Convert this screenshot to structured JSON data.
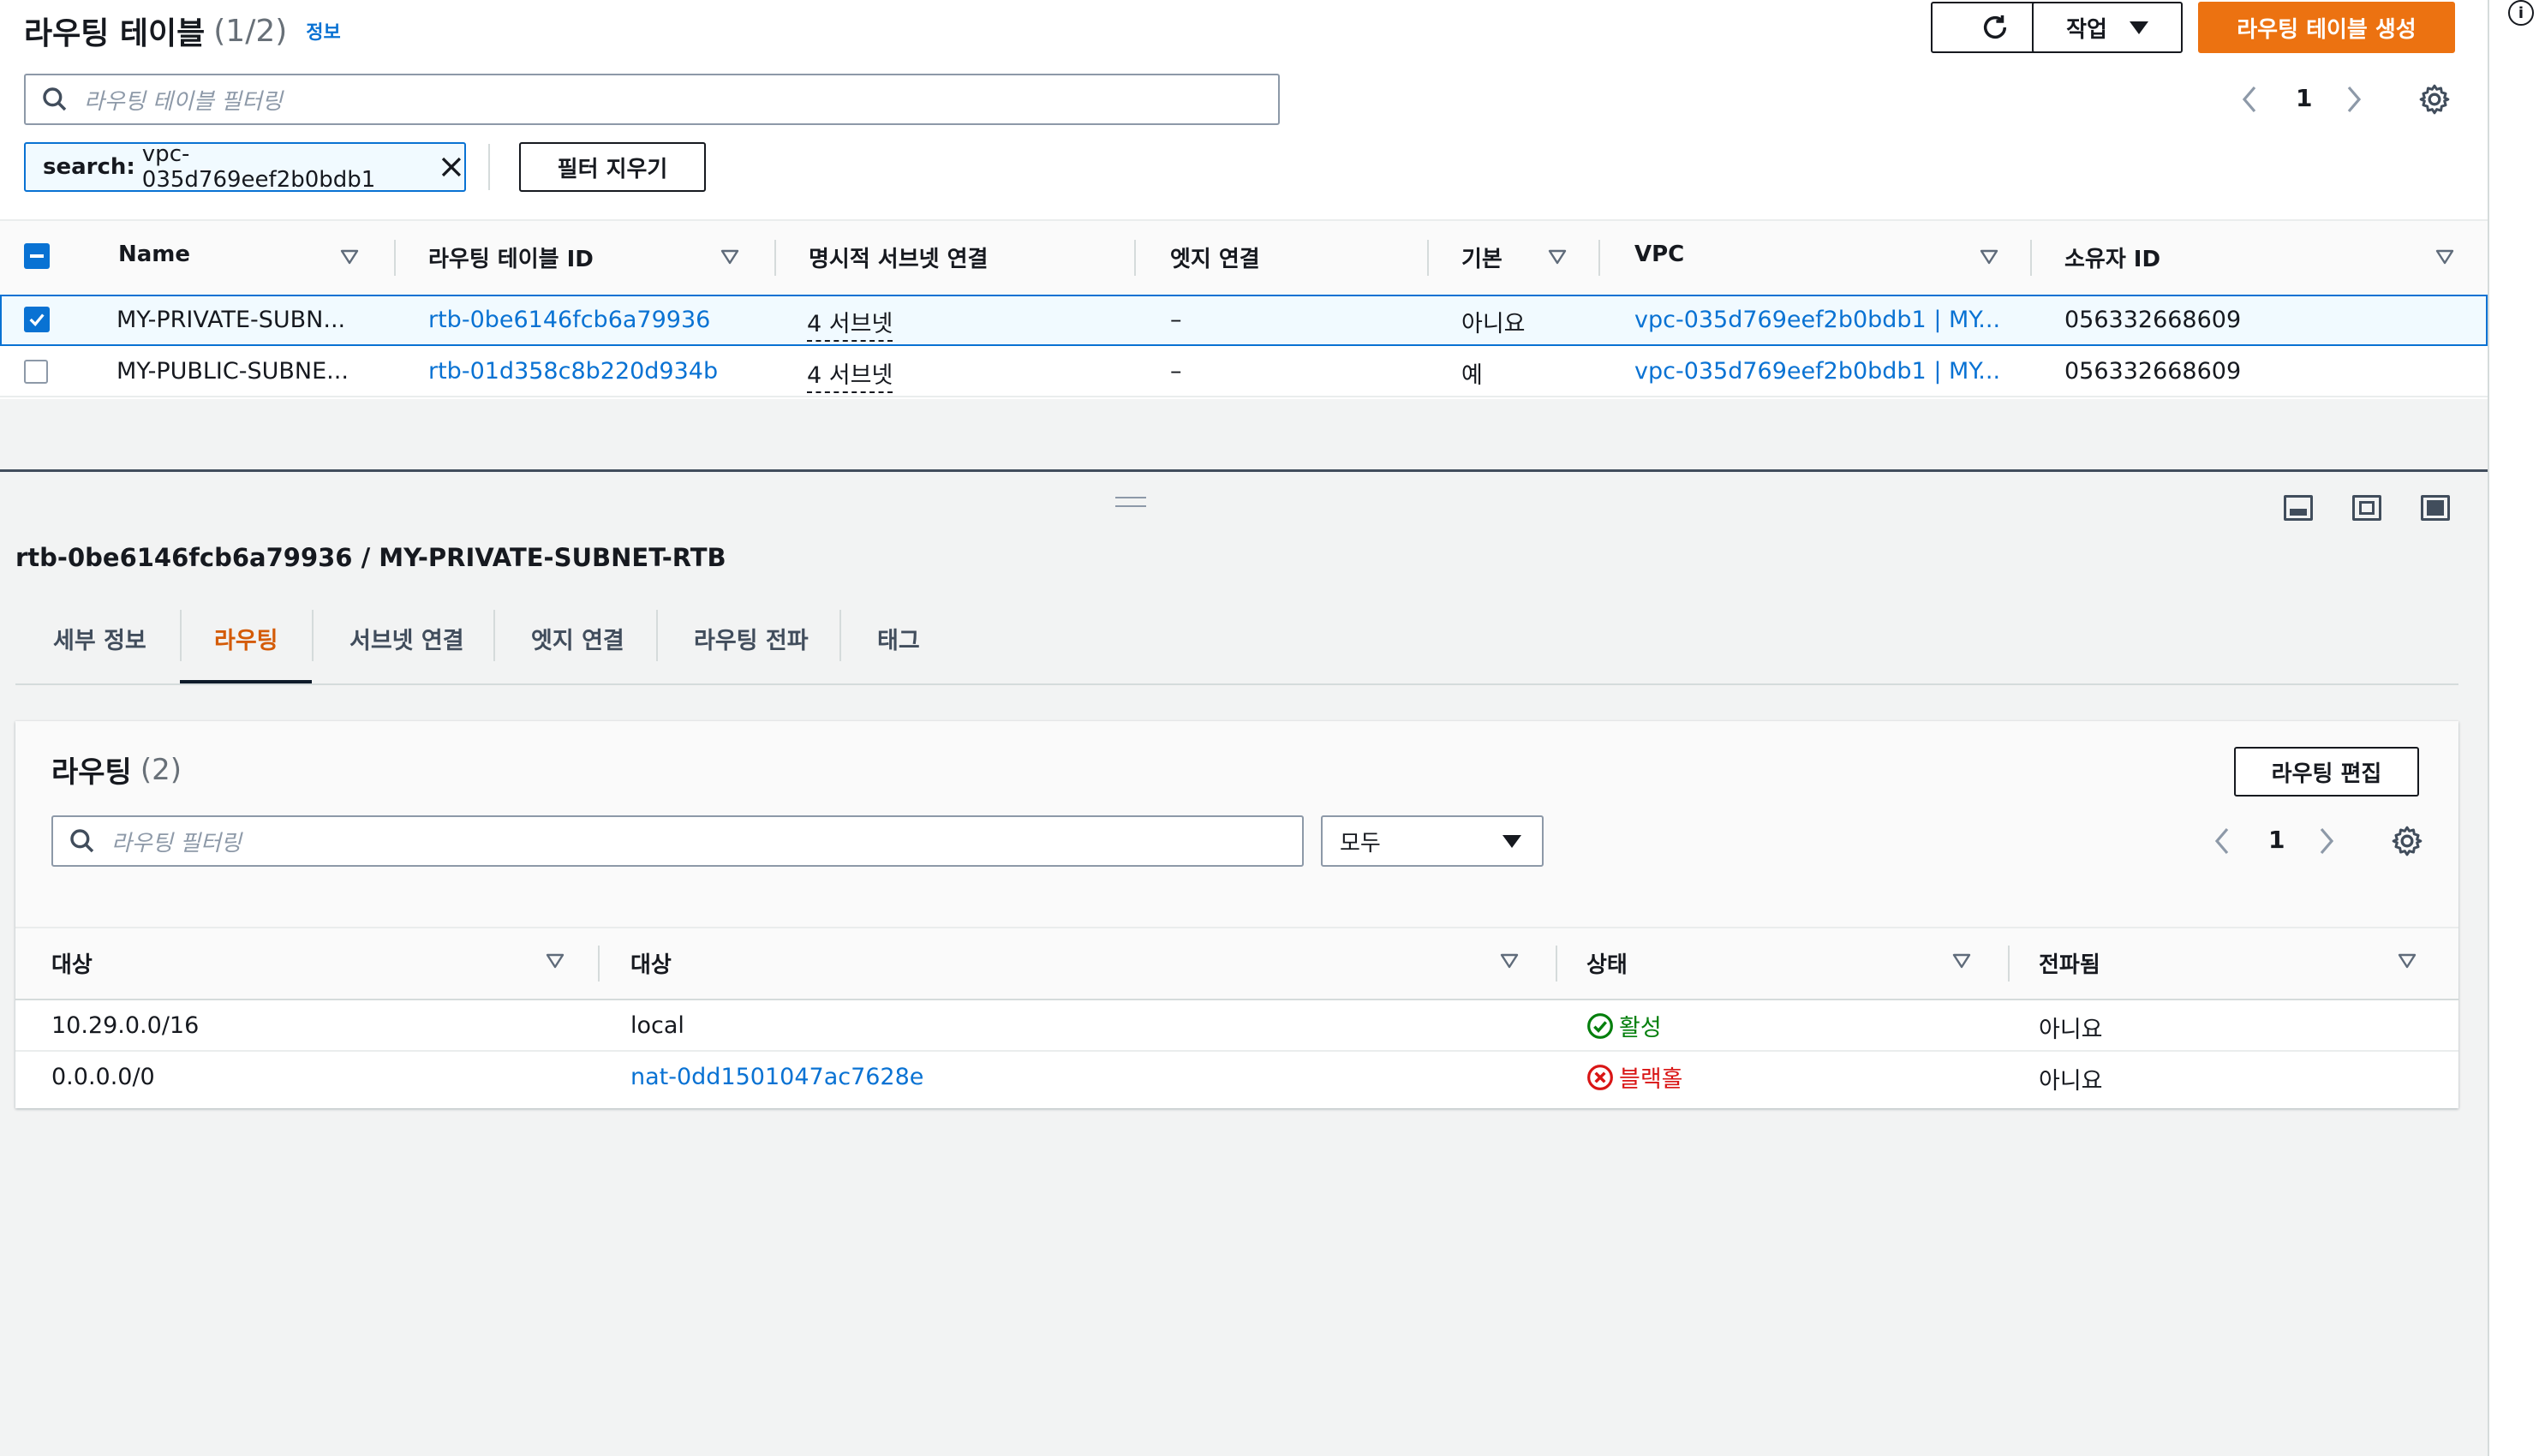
{
  "top": {
    "title": "라우팅 테이블",
    "count": "(1/2)",
    "info_link": "정보",
    "action_label": "작업",
    "create_label": "라우팅 테이블 생성",
    "search_placeholder": "라우팅 테이블 필터링",
    "page": "1",
    "filter_token_key": "search:",
    "filter_token_value": "vpc-035d769eef2b0bdb1",
    "clear_filters": "필터 지우기",
    "columns": [
      "Name",
      "라우팅 테이블 ID",
      "명시적 서브넷 연결",
      "엣지 연결",
      "기본",
      "VPC",
      "소유자 ID"
    ],
    "rows": [
      {
        "checked": true,
        "name": "MY-PRIVATE-SUBN...",
        "id": "rtb-0be6146fcb6a79936",
        "subnets": "4 서브넷",
        "edge": "–",
        "main": "아니요",
        "vpc": "vpc-035d769eef2b0bdb1 | MY...",
        "owner": "056332668609"
      },
      {
        "checked": false,
        "name": "MY-PUBLIC-SUBNE...",
        "id": "rtb-01d358c8b220d934b",
        "subnets": "4 서브넷",
        "edge": "–",
        "main": "예",
        "vpc": "vpc-035d769eef2b0bdb1 | MY...",
        "owner": "056332668609"
      }
    ]
  },
  "detail": {
    "title": "rtb-0be6146fcb6a79936 / MY-PRIVATE-SUBNET-RTB",
    "tabs": [
      "세부 정보",
      "라우팅",
      "서브넷 연결",
      "엣지 연결",
      "라우팅 전파",
      "태그"
    ],
    "active_tab": 1
  },
  "routes": {
    "title": "라우팅",
    "count": "(2)",
    "edit_label": "라우팅 편집",
    "search_placeholder": "라우팅 필터링",
    "select_value": "모두",
    "page": "1",
    "columns": [
      "대상",
      "대상",
      "상태",
      "전파됨"
    ],
    "rows": [
      {
        "destination": "10.29.0.0/16",
        "target": "local",
        "target_link": false,
        "status": "활성",
        "status_kind": "active",
        "propagated": "아니요"
      },
      {
        "destination": "0.0.0.0/0",
        "target": "nat-0dd1501047ac7628e",
        "target_link": true,
        "status": "블랙홀",
        "status_kind": "blackhole",
        "propagated": "아니요"
      }
    ]
  },
  "colors": {
    "primary": "#ec7211",
    "link": "#0972d3",
    "selected_row_border": "#0972d3",
    "selected_row_bg": "#f1faff",
    "success": "#037f0c",
    "error": "#d91515"
  }
}
